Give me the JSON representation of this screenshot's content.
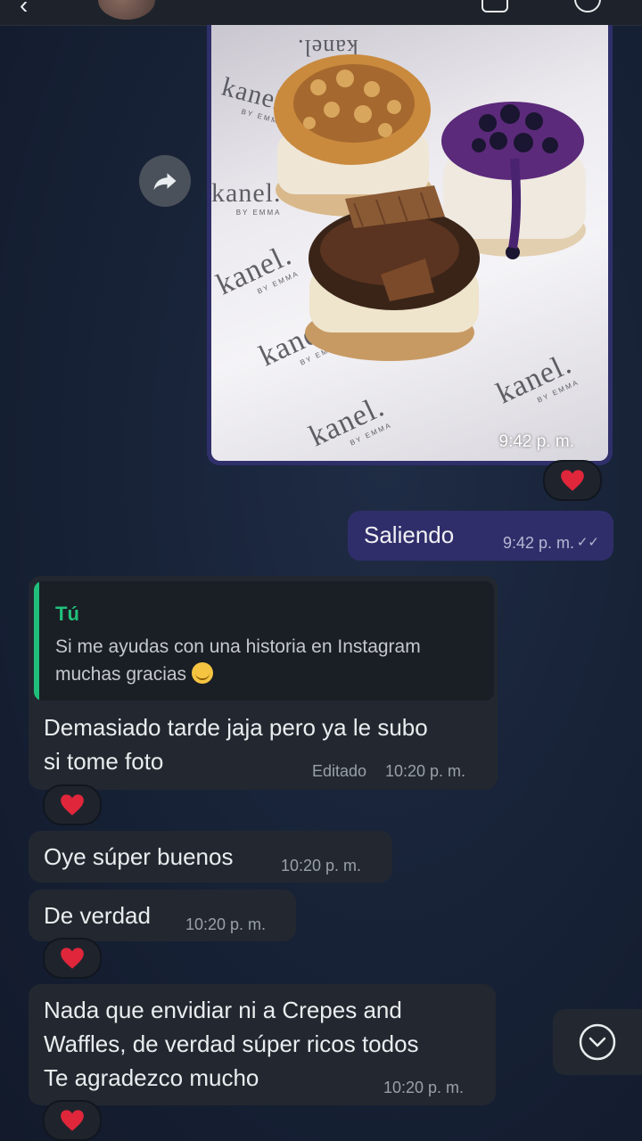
{
  "photo_message": {
    "watermarks": [
      "kanel.",
      "kanel.",
      "kanel.",
      "kanel.",
      "kanel.",
      "kanel.",
      "kanel."
    ],
    "watermark_sub": "BY EMMA",
    "time": "9:42 p. m."
  },
  "outgoing": {
    "text": "Saliendo",
    "time": "9:42 p. m."
  },
  "reply_message": {
    "quote_author": "Tú",
    "quote_text": "Si me ayudas con una historia en Instagram\nmuchas gracias",
    "text": "Demasiado tarde jaja pero ya le subo\nsi tome foto",
    "edited_label": "Editado",
    "time": "10:20 p. m."
  },
  "message_2": {
    "text": "Oye súper buenos",
    "time": "10:20 p. m."
  },
  "message_3": {
    "text": "De verdad",
    "time": "10:20 p. m."
  },
  "message_4": {
    "text": "Nada que envidiar ni a Crepes and\nWaffles, de verdad súper ricos todos\nTe agradezco mucho",
    "time": "10:20 p. m."
  },
  "colors": {
    "background": "#182338",
    "outgoing_bubble": "#302e6a",
    "incoming_bubble": "#232830",
    "quote_accent": "#21c07a",
    "reaction_heart": "#e0263b"
  },
  "icons": {
    "forward": "forward-arrow-icon",
    "reaction": "red-heart-icon",
    "scroll": "chevron-down-circle-icon",
    "read": "double-check-icon"
  }
}
